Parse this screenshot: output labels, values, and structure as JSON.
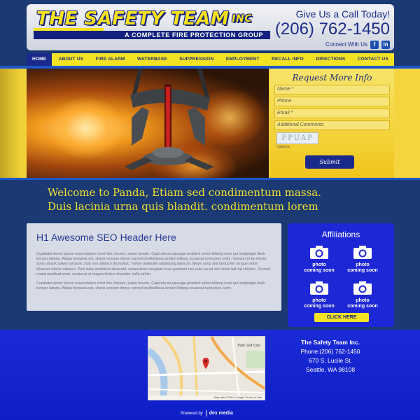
{
  "header": {
    "logo_title": "THE SAFETY TEAM",
    "logo_inc": "INC",
    "logo_tagline": "A COMPLETE FIRE PROTECTION GROUP",
    "call_label": "Give Us a Call Today!",
    "phone": "(206) 762-1450",
    "connect_label": "Connect With Us",
    "social": [
      "f",
      "in"
    ]
  },
  "nav": {
    "items": [
      "HOME",
      "ABOUT US",
      "FIRE ALARM",
      "WATERBASE",
      "SUPPRESSION",
      "EMPLOYMENT",
      "RECALL INFO",
      "DIRECTIONS",
      "CONTACT US"
    ],
    "active": "HOME"
  },
  "form": {
    "title": "Request More Info",
    "fields": [
      "Name *",
      "Phone",
      "Email *",
      "Additional Comments"
    ],
    "captcha_text": "FPUAP",
    "captcha_label": "Captcha",
    "submit_label": "Submit"
  },
  "welcome": {
    "line1": "Welcome to Panda, Etiam sed condimentum massa.",
    "line2": "Duis lacinia urna quis blandit. condimentum lorem"
  },
  "content": {
    "heading": "H1 Awesome SEO Header Here",
    "paragraph1": "Cupidatat doner bacon excercitation short ribs chicken, swine boudin. Capicola ea sausage proident sirloin biltong esse qui landjaeger flank tempor laboris. Aliqua bresaola est, shank venison ribeye corned beefkielbasa brisket biltong occaecat turducken anim. Venison tri-tip minim, ad eu shank turkey tail pork chop non ullamco drumstick. Turkey andouille adipisicing laborum ribeye rump sint turducken tongue sirloin leberkas dolore ullamco. Pork belly incididunt deserunt, consectetur voluptate irure pastrami non aute ea ad nisi sirloin ball tip chicken. Ground round meatloaf anim, occaecat ut magna brisket shoulder nulla sirloin.",
    "paragraph2": "Cupidatat doner bacon excercitation short ribs chicken, swine boudin. Capicola ea sausage proident sirloin biltong esse qui landjaeger flank tempor laboris. Aliqua bresaola est, shank venison ribeye corned beefkielbasa brisket biltong occaecat turducken anim."
  },
  "affiliations": {
    "title": "Affiliations",
    "items": [
      {
        "line1": "photo",
        "line2": "coming soon"
      },
      {
        "line1": "photo",
        "line2": "coming soon"
      },
      {
        "line1": "photo",
        "line2": "coming soon"
      },
      {
        "line1": "photo",
        "line2": "coming soon"
      }
    ],
    "button": "CLICK HERE"
  },
  "footer": {
    "company": "The Safety Team Inc.",
    "phone": "Phone:(206) 762-1450",
    "street": "670 S. Lucile St.",
    "city": "Seattle, WA 98108",
    "map_label": "Park Golf Club",
    "map_footer": "Map data ©2014 Google  Terms of Use",
    "powered_by": "Powered by",
    "dex": "dex media"
  },
  "colors": {
    "navy": "#1b3a73",
    "yellow": "#f3e324",
    "brand_blue": "#1a2a8c",
    "footer_blue": "#1a2ad6"
  }
}
